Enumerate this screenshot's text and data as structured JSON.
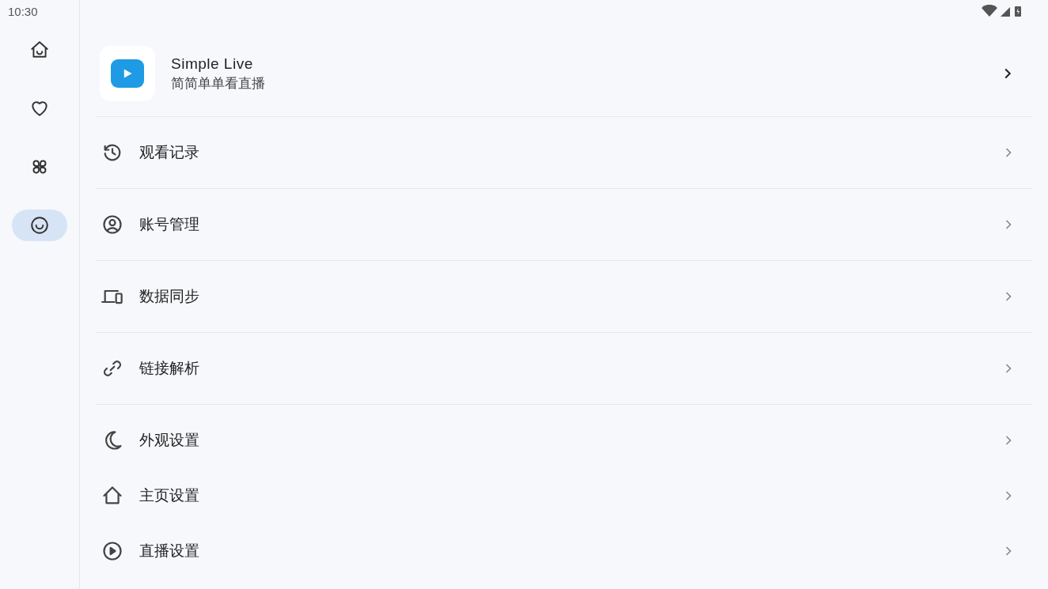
{
  "status_bar": {
    "time": "10:30"
  },
  "nav": [
    {
      "kind": "home",
      "selected": false
    },
    {
      "kind": "heart",
      "selected": false
    },
    {
      "kind": "grid",
      "selected": false
    },
    {
      "kind": "smiley",
      "selected": true
    }
  ],
  "app_header": {
    "title": "Simple Live",
    "subtitle": "简简单单看直播"
  },
  "menu_groups": [
    [
      {
        "kind": "history",
        "label": "观看记录"
      }
    ],
    [
      {
        "kind": "account",
        "label": "账号管理"
      }
    ],
    [
      {
        "kind": "devices",
        "label": "数据同步"
      }
    ],
    [
      {
        "kind": "link",
        "label": "链接解析"
      }
    ],
    [
      {
        "kind": "moon",
        "label": "外观设置"
      },
      {
        "kind": "home",
        "label": "主页设置"
      },
      {
        "kind": "play",
        "label": "直播设置"
      }
    ]
  ]
}
